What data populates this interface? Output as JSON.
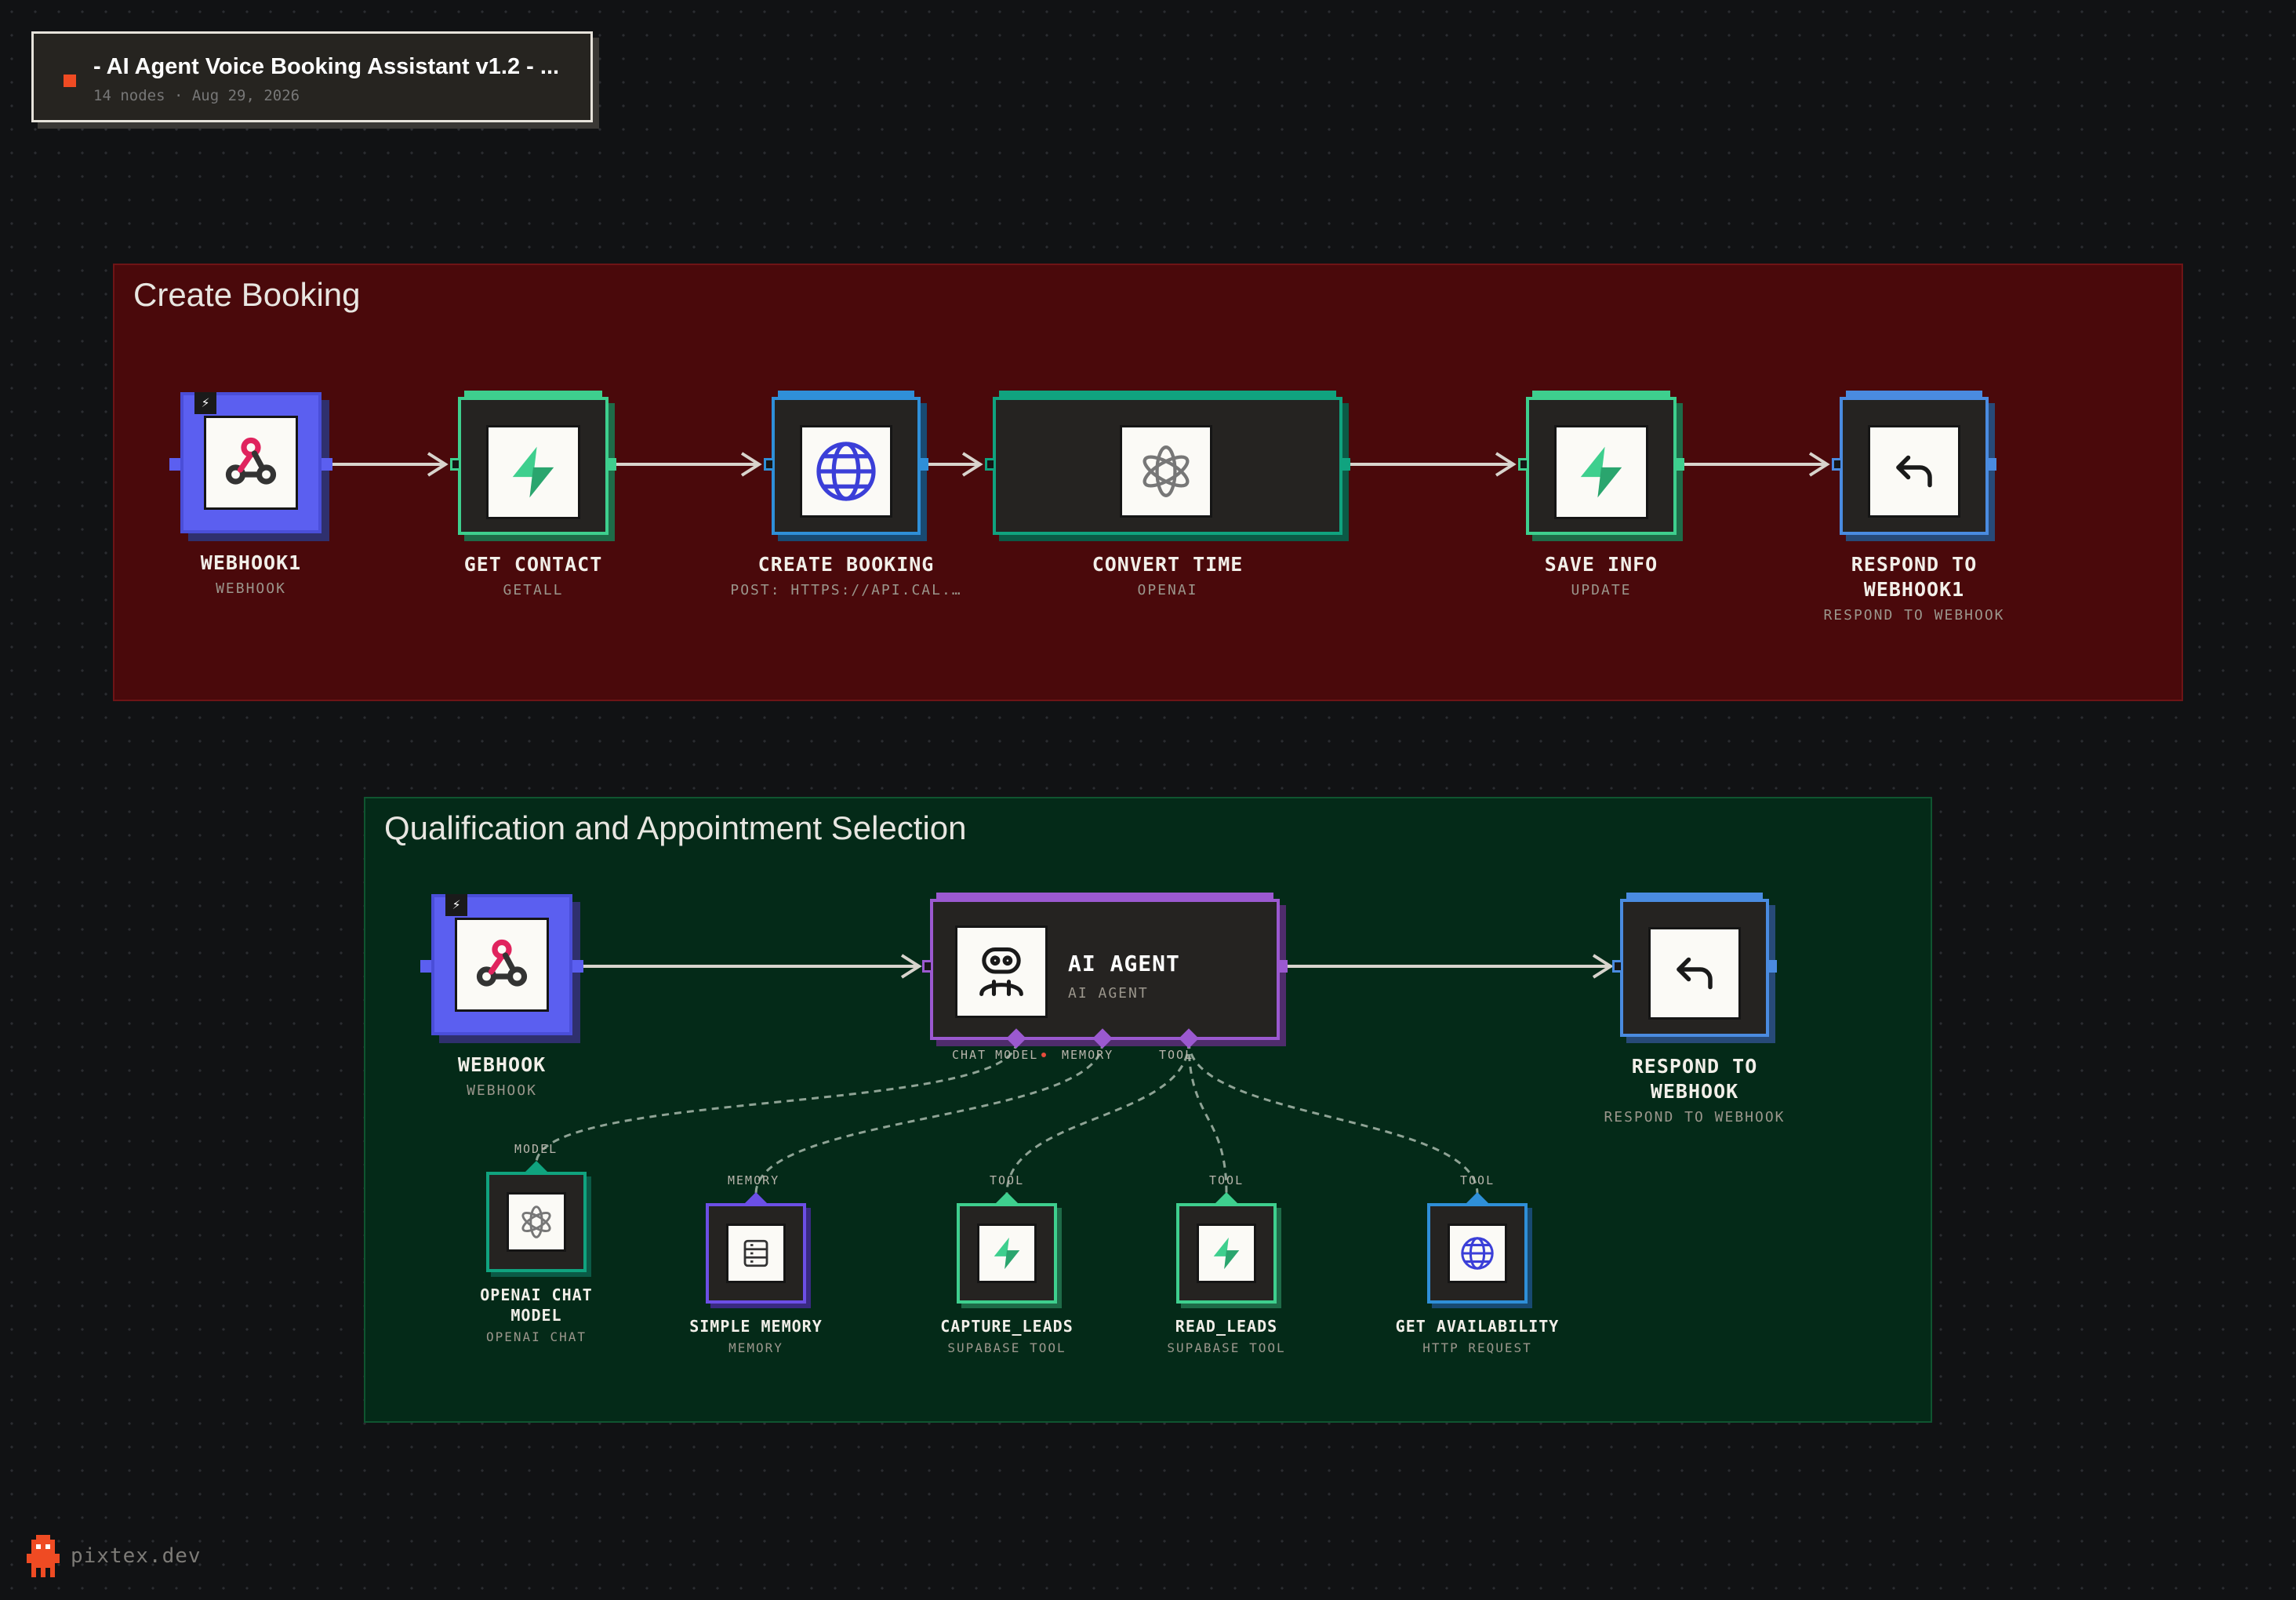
{
  "header": {
    "title": "- AI Agent Voice Booking Assistant v1.2 - ...",
    "meta": "14 nodes · Aug 29, 2026"
  },
  "groups": [
    {
      "title": "Create Booking",
      "color": "#4a090b"
    },
    {
      "title": "Qualification and Appointment Selection",
      "color": "#042a18"
    }
  ],
  "colors": {
    "webhook": "#5b5ff0",
    "supabase": "#3ecf8e",
    "http": "#2f8fd8",
    "openai": "#10a37f",
    "respond": "#4a8be0",
    "agent": "#9b59d0",
    "memory": "#6c4fe6"
  },
  "nodes": {
    "webhook1": {
      "name": "WEBHOOK1",
      "sub": "WEBHOOK",
      "icon": "webhook-icon"
    },
    "get_contact": {
      "name": "GET CONTACT",
      "sub": "GETALL",
      "icon": "supabase-bolt-icon"
    },
    "create_booking": {
      "name": "CREATE BOOKING",
      "sub": "POST: HTTPS://API.CAL.…",
      "icon": "globe-icon"
    },
    "convert_time": {
      "name": "CONVERT TIME",
      "sub": "OPENAI",
      "icon": "openai-icon"
    },
    "save_info": {
      "name": "SAVE INFO",
      "sub": "UPDATE",
      "icon": "supabase-bolt-icon"
    },
    "respond1": {
      "name": "RESPOND TO WEBHOOK1",
      "sub": "RESPOND TO WEBHOOK",
      "icon": "reply-arrow-icon"
    },
    "webhook": {
      "name": "WEBHOOK",
      "sub": "WEBHOOK",
      "icon": "webhook-icon"
    },
    "ai_agent": {
      "name": "AI AGENT",
      "sub": "AI AGENT",
      "icon": "robot-icon"
    },
    "respond": {
      "name": "RESPOND TO WEBHOOK",
      "sub": "RESPOND TO WEBHOOK",
      "icon": "reply-arrow-icon"
    },
    "openai_chat": {
      "name": "OPENAI CHAT MODEL",
      "sub": "OPENAI CHAT",
      "icon": "openai-icon"
    },
    "simple_memory": {
      "name": "SIMPLE MEMORY",
      "sub": "MEMORY",
      "icon": "database-icon"
    },
    "capture_leads": {
      "name": "CAPTURE_LEADS",
      "sub": "SUPABASE TOOL",
      "icon": "supabase-bolt-icon"
    },
    "read_leads": {
      "name": "READ_LEADS",
      "sub": "SUPABASE TOOL",
      "icon": "supabase-bolt-icon"
    },
    "get_availability": {
      "name": "GET AVAILABILITY",
      "sub": "HTTP REQUEST",
      "icon": "globe-icon"
    }
  },
  "ports": {
    "chat_model": "CHAT MODEL",
    "memory": "MEMORY",
    "tool": "TOOL",
    "model": "MODEL"
  },
  "brand": {
    "text": "pixtex.dev"
  }
}
